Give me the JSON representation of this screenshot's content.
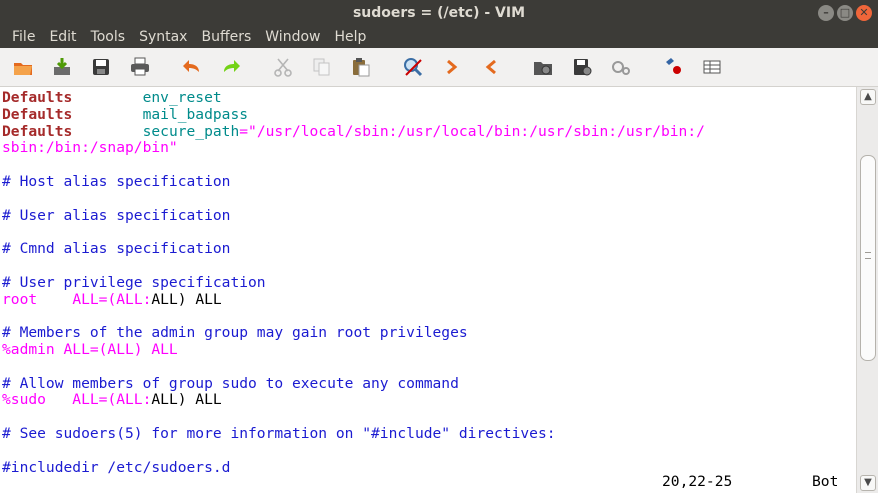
{
  "window": {
    "title": "sudoers = (/etc) - VIM",
    "controls": [
      "minimize",
      "maximize",
      "close"
    ]
  },
  "menu": [
    "File",
    "Edit",
    "Tools",
    "Syntax",
    "Buffers",
    "Window",
    "Help"
  ],
  "toolbar": {
    "icons": [
      "open-file-icon",
      "save-file-icon",
      "save-all-icon",
      "print-icon",
      "undo-icon",
      "redo-icon",
      "cut-icon",
      "copy-icon",
      "paste-icon",
      "find-replace-icon",
      "find-next-icon",
      "find-prev-icon",
      "load-session-icon",
      "save-session-icon",
      "run-script-icon",
      "make-icon",
      "ctags-icon"
    ]
  },
  "editor": {
    "lines": [
      [
        {
          "t": "Defaults",
          "c": "k"
        },
        {
          "t": "        ",
          "c": "n"
        },
        {
          "t": "env_reset",
          "c": "t"
        }
      ],
      [
        {
          "t": "Defaults",
          "c": "k"
        },
        {
          "t": "        ",
          "c": "n"
        },
        {
          "t": "mail_badpass",
          "c": "t"
        }
      ],
      [
        {
          "t": "Defaults",
          "c": "k"
        },
        {
          "t": "        ",
          "c": "n"
        },
        {
          "t": "secure_path",
          "c": "t"
        },
        {
          "t": "=\"/usr/local/sbin:/usr/local/bin:/usr/sbin:/usr/bin:/",
          "c": "s"
        }
      ],
      [
        {
          "t": "sbin:/bin:/snap/bin\"",
          "c": "s"
        }
      ],
      [],
      [
        {
          "t": "# Host alias specification",
          "c": "c"
        }
      ],
      [],
      [
        {
          "t": "# User alias specification",
          "c": "c"
        }
      ],
      [],
      [
        {
          "t": "# Cmnd alias specification",
          "c": "c"
        }
      ],
      [],
      [
        {
          "t": "# User privilege specification",
          "c": "c"
        }
      ],
      [
        {
          "t": "root",
          "c": "s"
        },
        {
          "t": "    ",
          "c": "n"
        },
        {
          "t": "ALL=(ALL:",
          "c": "s"
        },
        {
          "t": "ALL) ALL",
          "c": "n"
        }
      ],
      [],
      [
        {
          "t": "# Members of the admin group may gain root privileges",
          "c": "c"
        }
      ],
      [
        {
          "t": "%admin ALL=(ALL) ALL",
          "c": "s"
        }
      ],
      [],
      [
        {
          "t": "# Allow members of group sudo to execute any command",
          "c": "c"
        }
      ],
      [
        {
          "t": "%sudo",
          "c": "s"
        },
        {
          "t": "   ",
          "c": "n"
        },
        {
          "t": "ALL=(ALL:",
          "c": "s"
        },
        {
          "t": "ALL) ALL",
          "c": "n"
        }
      ],
      [],
      [
        {
          "t": "# See sudoers(5) for more information on \"#include\" directives:",
          "c": "c"
        }
      ],
      [],
      [
        {
          "t": "#includedir /etc/sudoers.d",
          "c": "c"
        }
      ]
    ]
  },
  "status": {
    "position": "20,22-25",
    "scroll": "Bot"
  }
}
